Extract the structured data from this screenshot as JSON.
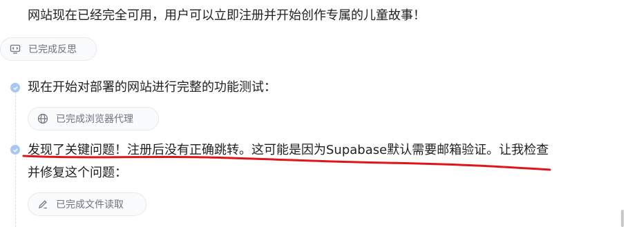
{
  "messages": {
    "line1": "网站现在已经完全可用，用户可以立即注册并开始创作专属的儿童故事！",
    "step1_text": "现在开始对部署的网站进行完整的功能测试：",
    "step2_text_line1": "发现了关键问题！注册后没有正确跳转。这可能是因为Supabase默认需要邮箱验证。让我检查",
    "step2_text_line2": "并修复这个问题："
  },
  "pills": {
    "reflection": {
      "label": "已完成反思",
      "icon": "monitor-code-icon"
    },
    "browser": {
      "label": "已完成浏览器代理",
      "icon": "globe-icon"
    },
    "file": {
      "label": "已完成文件读取",
      "icon": "pencil-icon"
    }
  },
  "colors": {
    "dot": "#a9c7f5",
    "underline": "#e0141b",
    "pill_border": "#e6e8eb",
    "pill_text": "#6b7280"
  }
}
